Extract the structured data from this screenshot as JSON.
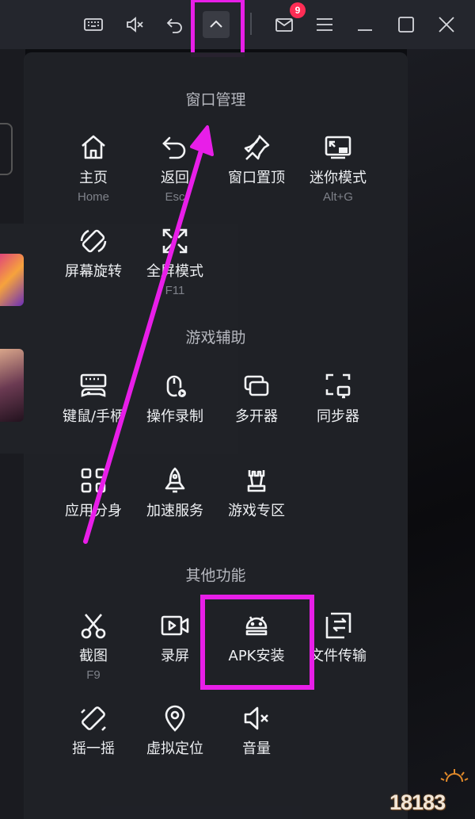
{
  "titlebar": {
    "buttons": [
      {
        "name": "keyboard-icon"
      },
      {
        "name": "mute-icon"
      },
      {
        "name": "undo-icon"
      },
      {
        "name": "chevron-up-icon"
      },
      {
        "name": "mail-icon"
      },
      {
        "name": "menu-icon"
      },
      {
        "name": "minimize-icon"
      },
      {
        "name": "maximize-icon"
      },
      {
        "name": "close-icon"
      }
    ],
    "mail_badge": "9"
  },
  "sections": {
    "window": {
      "title": "窗口管理"
    },
    "game": {
      "title": "游戏辅助"
    },
    "other": {
      "title": "其他功能"
    }
  },
  "items": {
    "home": {
      "label": "主页",
      "shortcut": "Home",
      "icon": "home-icon"
    },
    "back": {
      "label": "返回",
      "shortcut": "Esc",
      "icon": "back-icon"
    },
    "pin": {
      "label": "窗口置顶",
      "icon": "pin-icon"
    },
    "mini": {
      "label": "迷你模式",
      "shortcut": "Alt+G",
      "icon": "mini-mode-icon"
    },
    "rotate": {
      "label": "屏幕旋转",
      "icon": "rotate-icon"
    },
    "fullscreen": {
      "label": "全屏模式",
      "shortcut": "F11",
      "icon": "fullscreen-icon"
    },
    "keymap": {
      "label": "键鼠/手柄",
      "icon": "keyboard-gamepad-icon"
    },
    "macro": {
      "label": "操作录制",
      "icon": "record-operation-icon"
    },
    "multi": {
      "label": "多开器",
      "icon": "multi-instance-icon"
    },
    "sync": {
      "label": "同步器",
      "icon": "sync-icon"
    },
    "clone": {
      "label": "应用分身",
      "icon": "app-clone-icon"
    },
    "boost": {
      "label": "加速服务",
      "icon": "rocket-icon"
    },
    "gamezone": {
      "label": "游戏专区",
      "icon": "crown-icon"
    },
    "screenshot": {
      "label": "截图",
      "shortcut": "F9",
      "icon": "scissors-icon"
    },
    "screenrec": {
      "label": "录屏",
      "icon": "video-record-icon"
    },
    "apk": {
      "label": "APK安装",
      "icon": "android-icon"
    },
    "transfer": {
      "label": "文件传输",
      "icon": "file-transfer-icon"
    },
    "shake": {
      "label": "摇一摇",
      "icon": "shake-icon"
    },
    "location": {
      "label": "虚拟定位",
      "icon": "location-icon"
    },
    "volume": {
      "label": "音量",
      "icon": "volume-mute-icon"
    }
  },
  "watermark": {
    "text": "18183"
  },
  "colors": {
    "highlight": "#e81ee8",
    "panel_bg": "#202228",
    "badge": "#ff2d55"
  }
}
